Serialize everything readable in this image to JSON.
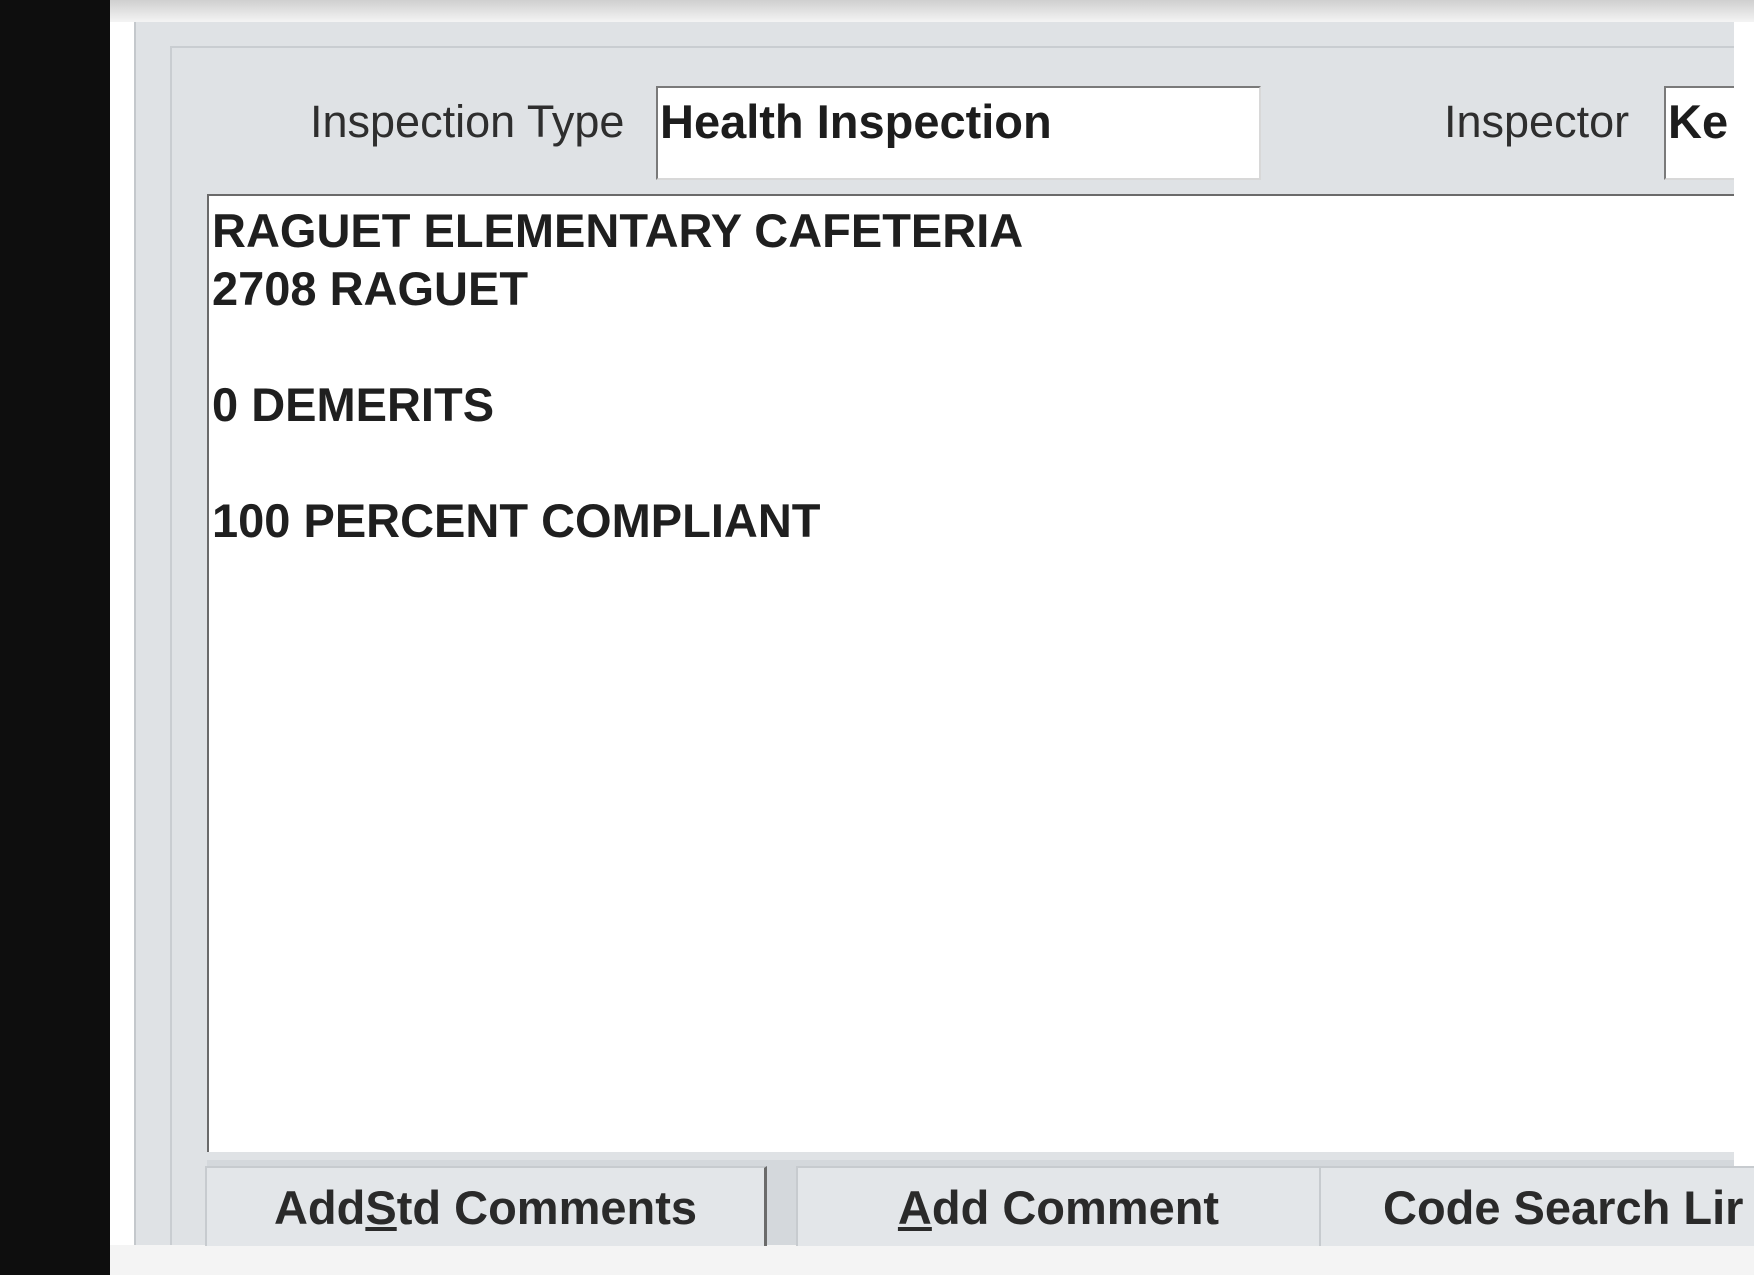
{
  "header": {
    "inspection_type_label": "Inspection Type",
    "inspection_type_value": "Health Inspection",
    "inspector_label": "Inspector",
    "inspector_value": "Ke"
  },
  "comments": {
    "lines": [
      "RAGUET ELEMENTARY CAFETERIA",
      "2708 RAGUET",
      "",
      "0 DEMERITS",
      "",
      "100 PERCENT COMPLIANT"
    ]
  },
  "buttons": {
    "add_std_comments": {
      "before": "Add ",
      "mnemonic": "S",
      "after": "td Comments"
    },
    "add_comment": {
      "before": "",
      "mnemonic": "A",
      "after": "dd Comment"
    },
    "code_search": {
      "label": "Code Search Lir"
    }
  }
}
